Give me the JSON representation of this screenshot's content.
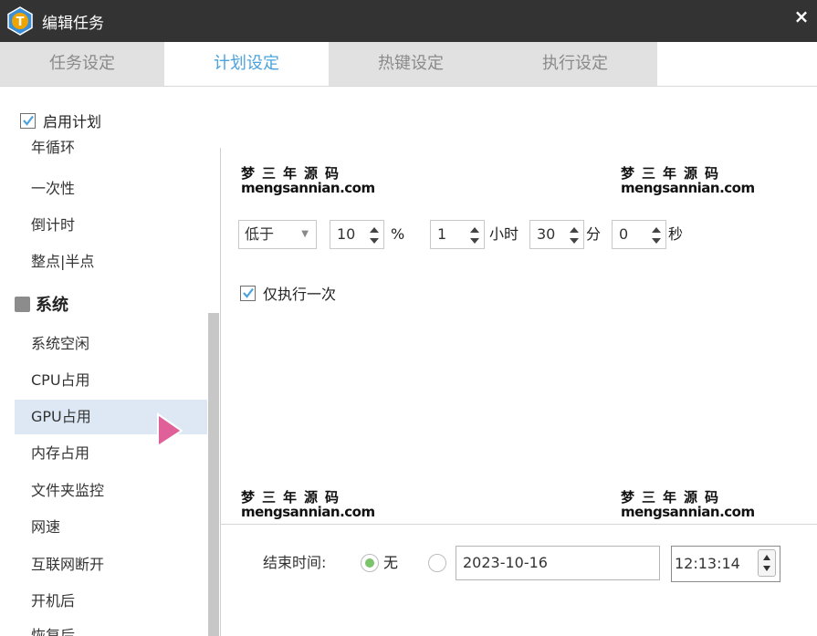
{
  "window": {
    "title": "编辑任务",
    "close_glyph": "×",
    "logo_letter": "T"
  },
  "tabs": [
    {
      "label": "任务设定",
      "active": false
    },
    {
      "label": "计划设定",
      "active": true
    },
    {
      "label": "热键设定",
      "active": false
    },
    {
      "label": "执行设定",
      "active": false
    }
  ],
  "sidebar": {
    "enable_plan": {
      "label": "启用计划",
      "checked": true
    },
    "items_top": [
      "年循环",
      "一次性",
      "倒计时",
      "整点|半点"
    ],
    "group": {
      "label": "系统"
    },
    "items_system": [
      "系统空闲",
      "CPU占用",
      "GPU占用",
      "内存占用",
      "文件夹监控",
      "网速",
      "互联网断开",
      "开机后",
      "恢复后"
    ],
    "selected": "GPU占用"
  },
  "watermark": {
    "chars": "梦三年源码",
    "url": "mengsannian.com"
  },
  "condition": {
    "comparator": "低于",
    "percent": "10",
    "percent_unit": "%",
    "hours": "1",
    "hours_unit": "小时",
    "minutes": "30",
    "minutes_unit": "分",
    "seconds": "0",
    "seconds_unit": "秒"
  },
  "run_once": {
    "label": "仅执行一次",
    "checked": true
  },
  "end_time": {
    "label": "结束时间:",
    "option_none": "无",
    "none_selected": true,
    "date": "2023-10-16",
    "time": "12:13:14"
  },
  "colors": {
    "titlebar": "#333333",
    "accent": "#4aa3df",
    "radio_dot": "#7cc36c",
    "pointer": "#e0609a"
  }
}
